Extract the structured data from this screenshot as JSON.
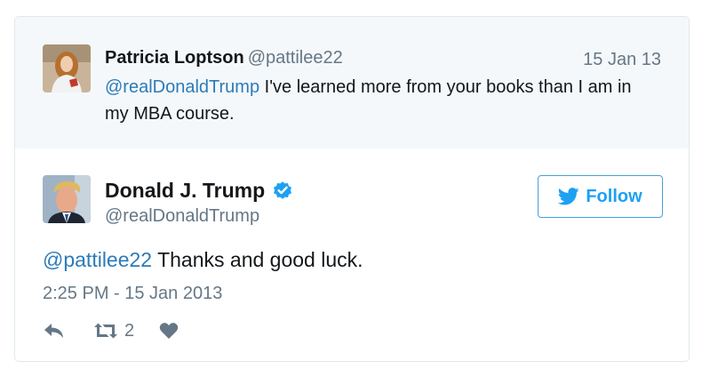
{
  "quoted_tweet": {
    "author_name": "Patricia Loptson",
    "author_handle": "@pattilee22",
    "date": "15 Jan 13",
    "mention": "@realDonaldTrump",
    "text": " I've learned more from your books than I am in my MBA course.",
    "avatar_icon": "profile-photo-woman"
  },
  "main_tweet": {
    "author_name": "Donald J. Trump",
    "author_handle": "@realDonaldTrump",
    "verified_icon": "verified-badge-icon",
    "follow_label": "Follow",
    "mention": "@pattilee22",
    "text": " Thanks and good luck.",
    "timestamp": "2:25 PM - 15 Jan 2013",
    "avatar_icon": "profile-photo-man",
    "actions": {
      "reply_icon": "reply-icon",
      "retweet_icon": "retweet-icon",
      "retweet_count": "2",
      "like_icon": "heart-icon"
    }
  },
  "colors": {
    "link": "#2b7bb9",
    "twitter_blue": "#1da1f2",
    "secondary_text": "#657786",
    "quoted_background": "#f5f8fa",
    "border": "#e1e8ed"
  }
}
